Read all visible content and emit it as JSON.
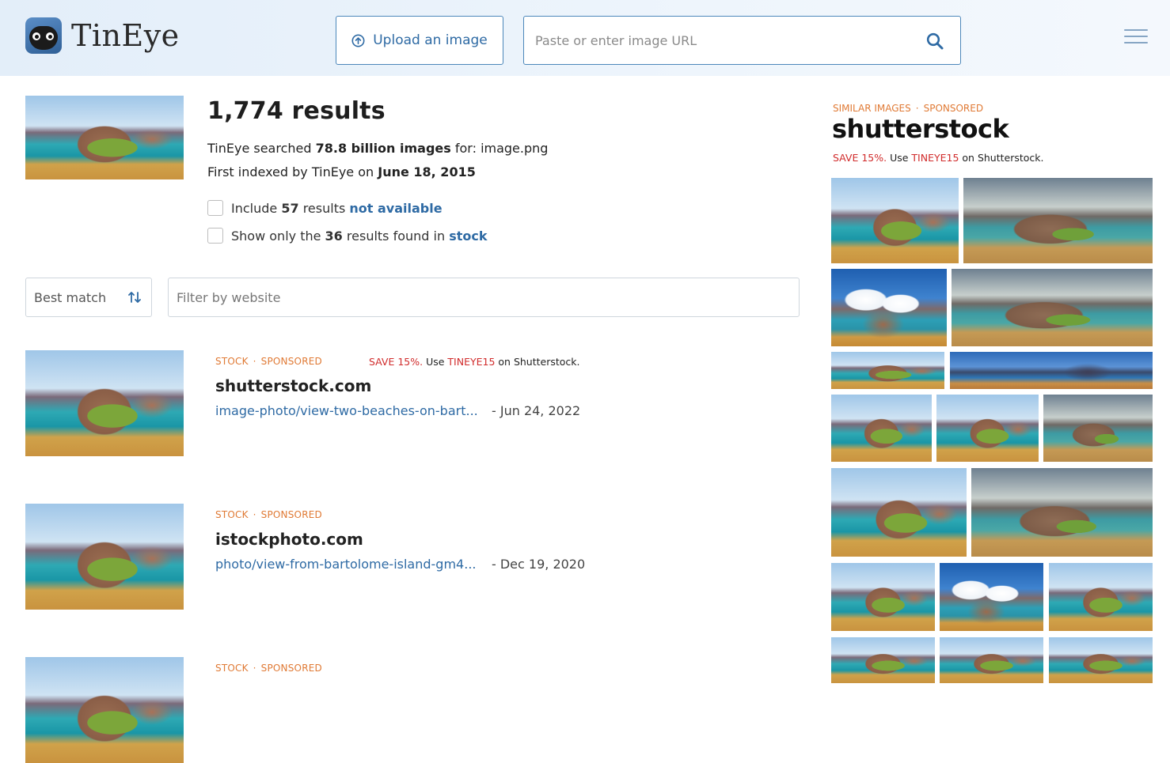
{
  "header": {
    "logo_text": "TinEye",
    "upload_label": "Upload an image",
    "url_placeholder": "Paste or enter image URL"
  },
  "summary": {
    "results_count": "1,774 results",
    "searched_prefix": "TinEye searched ",
    "searched_count": "78.8 billion images",
    "searched_for": " for: ",
    "filename": "image.png",
    "indexed_prefix": "First indexed by TinEye on ",
    "indexed_date": "June 18, 2015"
  },
  "options": {
    "include_prefix": "Include ",
    "include_count": "57",
    "include_mid": " results ",
    "include_link": "not available",
    "stock_prefix": "Show only the ",
    "stock_count": "36",
    "stock_mid": " results found in ",
    "stock_link": "stock"
  },
  "controls": {
    "sort_label": "Best match",
    "filter_placeholder": "Filter by website"
  },
  "results": [
    {
      "tag1": "STOCK",
      "tag2": "SPONSORED",
      "promo_save": "SAVE 15%.",
      "promo_use": " Use ",
      "promo_code": "TINEYE15",
      "promo_end": " on Shutterstock.",
      "site": "shutterstock.com",
      "link": "image-photo/view-two-beaches-on-bart...",
      "date": "- Jun 24, 2022"
    },
    {
      "tag1": "STOCK",
      "tag2": "SPONSORED",
      "site": "istockphoto.com",
      "link": "photo/view-from-bartolome-island-gm4...",
      "date": "- Dec 19, 2020"
    },
    {
      "tag1": "STOCK",
      "tag2": "SPONSORED"
    }
  ],
  "sidebar": {
    "tag1": "SIMILAR IMAGES",
    "tag2": "SPONSORED",
    "brand": "shutterstock",
    "promo_save": "SAVE 15%.",
    "promo_use": " Use ",
    "promo_code": "TINEYE15",
    "promo_end": " on Shutterstock."
  },
  "colors": {
    "link": "#2e6aa4",
    "tag_orange": "#e07a35",
    "promo_red": "#d12c2c",
    "header_bg": "#e3eef9"
  }
}
